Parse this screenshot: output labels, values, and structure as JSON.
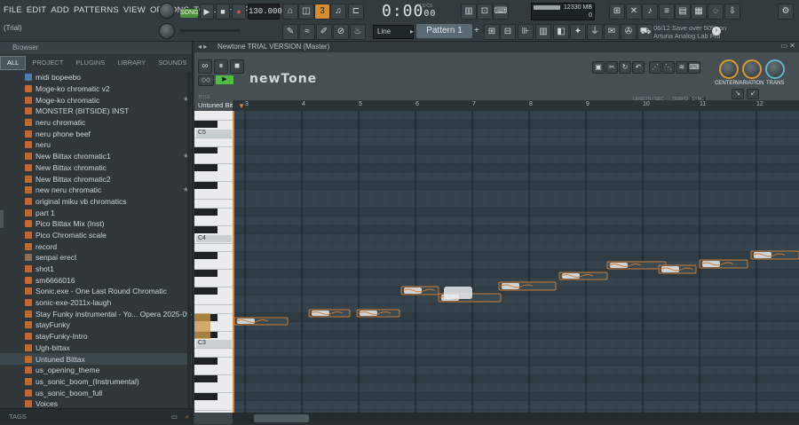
{
  "menu": [
    "FILE",
    "EDIT",
    "ADD",
    "PATTERNS",
    "VIEW",
    "OPTIONS",
    "TOOLS",
    "HELP"
  ],
  "top": {
    "trial": "(Trial)",
    "song_label": "SONG",
    "tempo": "130.000",
    "time": "0:00",
    "time_sub": "00",
    "time_unit": "M:S:CS",
    "pattern": "Pattern 1",
    "snap": "Line",
    "cpu_value": "12",
    "ram": "330 MB",
    "voices": "0",
    "promo_line1": "06/12  Save over 50% on",
    "promo_line2": "Arturia Analog Lab Pro"
  },
  "browser": {
    "title": "Browser",
    "tabs": [
      "ALL",
      "PROJECT",
      "PLUGINS",
      "LIBRARY",
      "SOUNDS",
      "STARRED"
    ],
    "items": [
      {
        "name": "midi bopeebo",
        "icon": "blue",
        "star": false
      },
      {
        "name": "Moge-ko chromatic v2",
        "icon": "orange",
        "star": false
      },
      {
        "name": "Moge-ko chromatic",
        "icon": "orange",
        "star": true
      },
      {
        "name": "MONSTER (BITSIDE) INST",
        "icon": "orange",
        "star": false
      },
      {
        "name": "neru chromatic",
        "icon": "orange",
        "star": false
      },
      {
        "name": "neru phone beef",
        "icon": "orange",
        "star": false
      },
      {
        "name": "neru",
        "icon": "orange",
        "star": false
      },
      {
        "name": "New Bittax chromatic1",
        "icon": "orange",
        "star": true
      },
      {
        "name": "New Bittax chromatic",
        "icon": "orange",
        "star": false
      },
      {
        "name": "New Bittax chromatic2",
        "icon": "orange",
        "star": false
      },
      {
        "name": "new neru chromatic",
        "icon": "orange",
        "star": true
      },
      {
        "name": "original miku vb chromatics",
        "icon": "orange",
        "star": false
      },
      {
        "name": "part 1",
        "icon": "orange",
        "star": false
      },
      {
        "name": "Pico Bittax Mix (Inst)",
        "icon": "orange",
        "star": false
      },
      {
        "name": "Pico Chromatic scale",
        "icon": "orange",
        "star": false
      },
      {
        "name": "record",
        "icon": "orange",
        "star": false
      },
      {
        "name": "senpai erect",
        "icon": "img",
        "star": false
      },
      {
        "name": "shot1",
        "icon": "orange",
        "star": false
      },
      {
        "name": "sm6666016",
        "icon": "orange",
        "star": false
      },
      {
        "name": "Sonic.exe - One Last Round Chromatic",
        "icon": "orange",
        "star": false
      },
      {
        "name": "sonic-exe-2011x-laugh",
        "icon": "orange",
        "star": false
      },
      {
        "name": "Stay Funky instrumental - Yo... Opera 2025-05-16 15-51-55",
        "icon": "orange",
        "star": false
      },
      {
        "name": "stayFunky",
        "icon": "orange",
        "star": false
      },
      {
        "name": "stayFunky-Intro",
        "icon": "orange",
        "star": false
      },
      {
        "name": "Ugh-bittax",
        "icon": "orange",
        "star": false
      },
      {
        "name": "Untuned Bittax",
        "icon": "orange",
        "star": false,
        "selected": true
      },
      {
        "name": "us_opening_theme",
        "icon": "orange",
        "star": false
      },
      {
        "name": "us_sonic_boom_(Instrumental)",
        "icon": "orange",
        "star": false
      },
      {
        "name": "us_sonic_boom_full",
        "icon": "orange",
        "star": false
      },
      {
        "name": "Voices",
        "icon": "orange",
        "star": false
      }
    ],
    "tags_label": "TAGS"
  },
  "plugin": {
    "window_title": "Newtone TRIAL VERSION (Master)",
    "brand": "newTone",
    "file_label": "TITLE",
    "file_name": "Untuned Bittax.wav",
    "length_label": "LENGTH / SEC",
    "length_value": "3907090",
    "tempo_label": "TEMPO",
    "sync_label": "SYNC",
    "knobs": [
      "CENTER",
      "VARIATION",
      "TRANS"
    ]
  },
  "roll": {
    "bars": [
      "3",
      "4",
      "5",
      "6",
      "7",
      "8",
      "9",
      "10",
      "11",
      "12"
    ],
    "octave_labels": [
      "C5",
      "C4",
      "C3"
    ]
  },
  "colors": {
    "accent_orange": "#d37a2f",
    "song_green": "#4f8f3a",
    "grid_bg": "#35444c"
  }
}
